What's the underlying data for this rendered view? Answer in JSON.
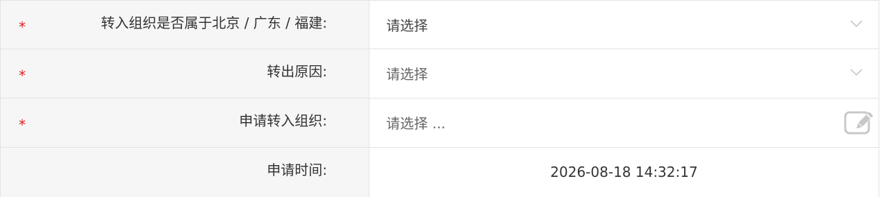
{
  "rows": [
    {
      "required_mark": "*",
      "label": "转入组织是否属于北京 / 广东 / 福建:",
      "value": "请选择",
      "control": "dropdown",
      "icon": "chevron-down-icon"
    },
    {
      "required_mark": "*",
      "label": "转出原因:",
      "value": "请选择",
      "control": "dropdown",
      "icon": "chevron-down-icon"
    },
    {
      "required_mark": "*",
      "label": "申请转入组织:",
      "value": "请选择 ...",
      "control": "picker",
      "icon": "edit-icon"
    },
    {
      "label": "申请时间:",
      "value": "2026-08-18 14:32:17",
      "control": "readonly"
    }
  ],
  "colors": {
    "label_background": "#f6f6f6",
    "border": "#e3e3e3",
    "required": "#e02020",
    "icon": "#c8c8c8"
  }
}
